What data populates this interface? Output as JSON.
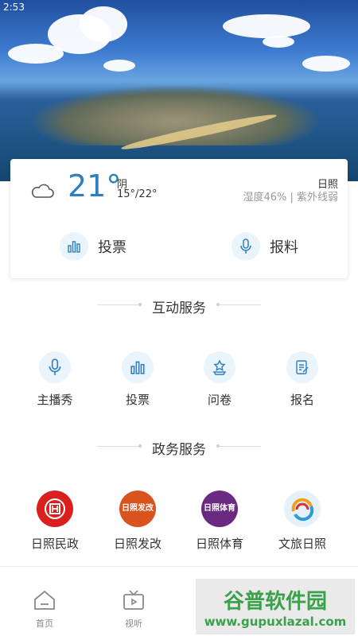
{
  "status_bar": {
    "time": "2:53"
  },
  "weather": {
    "temperature": "21°",
    "condition": "阴",
    "range": "15°/22°",
    "city": "日照",
    "detail": "湿度46% | 紫外线弱",
    "icon": "cloud-icon"
  },
  "quick_actions": [
    {
      "label": "投票",
      "icon": "bar-chart-icon"
    },
    {
      "label": "报料",
      "icon": "microphone-icon"
    }
  ],
  "interactive_services": {
    "title": "互动服务",
    "items": [
      {
        "label": "主播秀",
        "icon": "microphone-icon"
      },
      {
        "label": "投票",
        "icon": "bar-chart-icon"
      },
      {
        "label": "问卷",
        "icon": "trophy-icon"
      },
      {
        "label": "报名",
        "icon": "form-icon"
      }
    ]
  },
  "gov_services": {
    "title": "政务服务",
    "items": [
      {
        "label": "日照民政",
        "logo_text": "",
        "color": "#d9201f"
      },
      {
        "label": "日照发改",
        "logo_text": "日照发改",
        "color": "#d9531e"
      },
      {
        "label": "日照体育",
        "logo_text": "日照体育",
        "color": "#6b2a82"
      },
      {
        "label": "文旅日照",
        "logo_text": "",
        "color": "#e6f2fb"
      }
    ]
  },
  "bottom_nav": [
    {
      "label": "首页",
      "icon": "home-icon"
    },
    {
      "label": "视听",
      "icon": "tv-icon"
    }
  ],
  "watermark": {
    "title": "谷普软件园",
    "url": "www.gupuxlazal.com"
  },
  "colors": {
    "accent": "#2d7fc1",
    "icon_bg": "#eaf4fc"
  }
}
